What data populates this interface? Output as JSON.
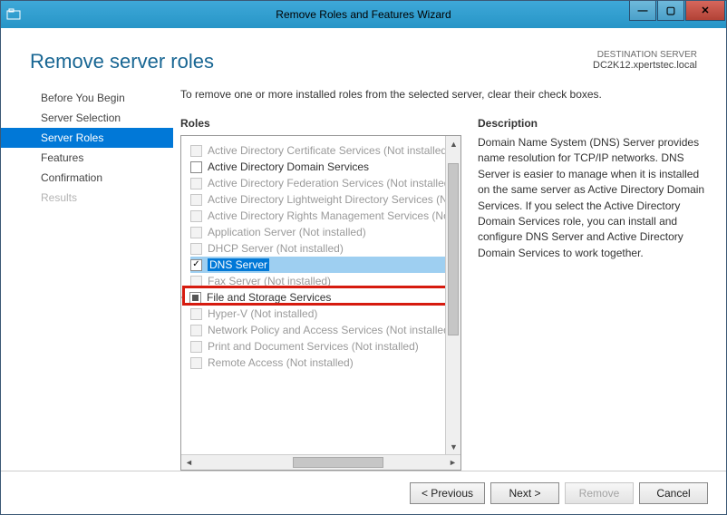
{
  "window": {
    "title": "Remove Roles and Features Wizard"
  },
  "header": {
    "pageTitle": "Remove server roles",
    "destLabel": "DESTINATION SERVER",
    "destServer": "DC2K12.xpertstec.local"
  },
  "sidebar": {
    "items": [
      {
        "label": "Before You Begin",
        "active": false,
        "disabled": false
      },
      {
        "label": "Server Selection",
        "active": false,
        "disabled": false
      },
      {
        "label": "Server Roles",
        "active": true,
        "disabled": false
      },
      {
        "label": "Features",
        "active": false,
        "disabled": false
      },
      {
        "label": "Confirmation",
        "active": false,
        "disabled": false
      },
      {
        "label": "Results",
        "active": false,
        "disabled": true
      }
    ]
  },
  "main": {
    "instruction": "To remove one or more installed roles from the selected server, clear their check boxes.",
    "rolesLabel": "Roles",
    "descLabel": "Description",
    "roles": [
      {
        "label": "Active Directory Certificate Services (Not installed)",
        "dim": true,
        "checked": false
      },
      {
        "label": "Active Directory Domain Services",
        "dim": false,
        "checked": false
      },
      {
        "label": "Active Directory Federation Services (Not installed)",
        "dim": true,
        "checked": false
      },
      {
        "label": "Active Directory Lightweight Directory Services (Not installed)",
        "dim": true,
        "checked": false
      },
      {
        "label": "Active Directory Rights Management Services (Not installed)",
        "dim": true,
        "checked": false
      },
      {
        "label": "Application Server (Not installed)",
        "dim": true,
        "checked": false
      },
      {
        "label": "DHCP Server (Not installed)",
        "dim": true,
        "checked": false
      },
      {
        "label": "DNS Server",
        "dim": false,
        "checked": true,
        "selected": true
      },
      {
        "label": "Fax Server (Not installed)",
        "dim": true,
        "checked": false
      },
      {
        "label": "File and Storage Services",
        "dim": false,
        "checked": "filled",
        "expandable": true
      },
      {
        "label": "Hyper-V (Not installed)",
        "dim": true,
        "checked": false
      },
      {
        "label": "Network Policy and Access Services (Not installed)",
        "dim": true,
        "checked": false
      },
      {
        "label": "Print and Document Services (Not installed)",
        "dim": true,
        "checked": false
      },
      {
        "label": "Remote Access (Not installed)",
        "dim": true,
        "checked": false
      }
    ],
    "description": "Domain Name System (DNS) Server provides name resolution for TCP/IP networks. DNS Server is easier to manage when it is installed on the same server as Active Directory Domain Services. If you select the Active Directory Domain Services role, you can install and configure DNS Server and Active Directory Domain Services to work together."
  },
  "buttons": {
    "previous": "< Previous",
    "next": "Next >",
    "remove": "Remove",
    "cancel": "Cancel"
  }
}
